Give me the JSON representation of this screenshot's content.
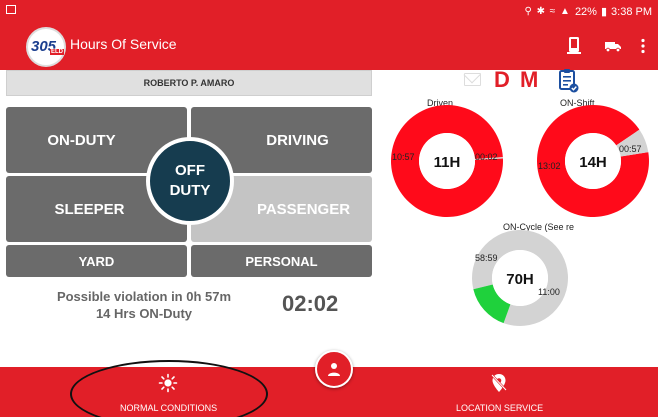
{
  "status_bar": {
    "battery": "22%",
    "time": "3:38 PM"
  },
  "app_bar": {
    "logo_main": "305",
    "logo_sub": "ELD",
    "title": "Hours Of Service",
    "actions": [
      "phone-icon",
      "truck-icon",
      "more-vert-icon"
    ]
  },
  "driver": {
    "name": "ROBERTO P. AMARO"
  },
  "duty": {
    "on_duty": "ON-DUTY",
    "driving": "DRIVING",
    "sleeper": "SLEEPER",
    "passenger": "PASSENGER",
    "yard": "YARD",
    "personal": "PERSONAL",
    "off_duty_line1": "OFF",
    "off_duty_line2": "DUTY"
  },
  "violation": {
    "line1": "Possible violation in 0h 57m",
    "line2": "14 Hrs ON-Duty",
    "clock": "02:02"
  },
  "indicators": {
    "d": "D",
    "m": "M"
  },
  "charts": {
    "driven": {
      "title": "Driven",
      "center": "11H",
      "used": "10:57",
      "remaining": "00:02",
      "used_fraction": 0.996
    },
    "on_shift": {
      "title": "ON-Shift",
      "center": "14H",
      "used": "13:02",
      "remaining": "00:57",
      "used_fraction": 0.931
    },
    "on_cycle": {
      "title": "ON-Cycle (See re",
      "center": "70H",
      "used": "58:59",
      "remaining": "11:00",
      "used_fraction": 0.843
    }
  },
  "colors": {
    "brand_red": "#e11f28",
    "used_red": "#ff0a1a",
    "remaining_gray": "#d3d3d3",
    "remaining_green": "#1fd13c",
    "off_duty_navy": "#163c4f"
  },
  "bottom_bar": {
    "normal_conditions": "NORMAL CONDITIONS",
    "location_service": "LOCATION SERVICE"
  }
}
